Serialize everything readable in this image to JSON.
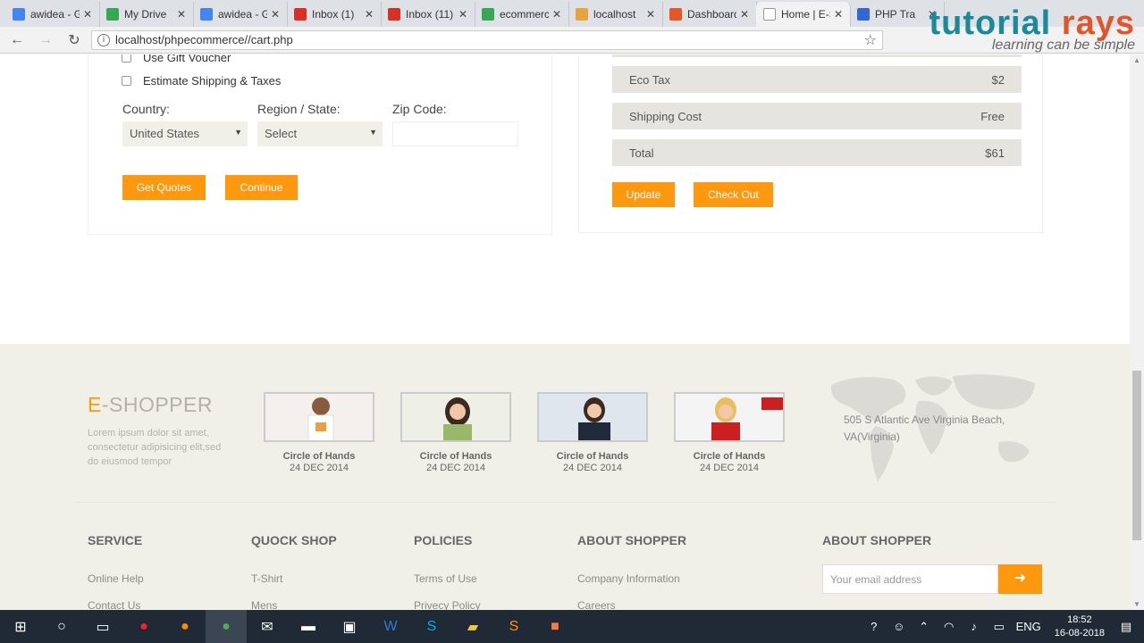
{
  "browser": {
    "tabs": [
      {
        "label": "awidea - Go",
        "color": "#4285f4"
      },
      {
        "label": "My Drive",
        "color": "#34a853"
      },
      {
        "label": "awidea - Go",
        "color": "#4285f4"
      },
      {
        "label": "Inbox (1)",
        "color": "#d93025"
      },
      {
        "label": "Inbox (11)",
        "color": "#d93025"
      },
      {
        "label": "ecommerce",
        "color": "#34a853"
      },
      {
        "label": "localhost",
        "color": "#e8a33d"
      },
      {
        "label": "Dashboard",
        "color": "#e65722"
      },
      {
        "label": "Home | E-Shopper",
        "color": "#999999"
      },
      {
        "label": "PHP Tra",
        "color": "#3367d6"
      }
    ],
    "url": "localhost/phpecommerce//cart.php"
  },
  "logo": {
    "brand_a": "tutorial ",
    "brand_b": "rays",
    "tagline": "learning can be simple"
  },
  "cart": {
    "gift_voucher_label": "Use Gift Voucher",
    "estimate_label": "Estimate Shipping & Taxes",
    "country_label": "Country:",
    "country_value": "United States",
    "region_label": "Region / State:",
    "region_value": "Select",
    "zip_label": "Zip Code:",
    "get_quotes": "Get Quotes",
    "continue": "Continue",
    "summary": [
      {
        "label": "Eco Tax",
        "value": "$2"
      },
      {
        "label": "Shipping Cost",
        "value": "Free"
      },
      {
        "label": "Total",
        "value": "$61"
      }
    ],
    "update": "Update",
    "checkout": "Check Out"
  },
  "footer": {
    "brand_e": "E",
    "brand_rest": "-SHOPPER",
    "blurb": "Lorem ipsum dolor sit amet, consectetur adipisicing elit,sed do eiusmod tempor",
    "videos": [
      {
        "caption": "Circle of Hands",
        "date": "24 DEC 2014"
      },
      {
        "caption": "Circle of Hands",
        "date": "24 DEC 2014"
      },
      {
        "caption": "Circle of Hands",
        "date": "24 DEC 2014"
      },
      {
        "caption": "Circle of Hands",
        "date": "24 DEC 2014"
      }
    ],
    "address": "505 S Atlantic Ave Virginia Beach, VA(Virginia)",
    "columns": [
      {
        "title": "SERVICE",
        "links": [
          "Online Help",
          "Contact Us"
        ]
      },
      {
        "title": "QUOCK SHOP",
        "links": [
          "T-Shirt",
          "Mens"
        ]
      },
      {
        "title": "POLICIES",
        "links": [
          "Terms of Use",
          "Privecy Policy"
        ]
      },
      {
        "title": "ABOUT SHOPPER",
        "links": [
          "Company Information",
          "Careers"
        ]
      }
    ],
    "subscribe_title": "ABOUT SHOPPER",
    "email_placeholder": "Your email address"
  },
  "taskbar": {
    "lang": "ENG",
    "time": "18:52",
    "date": "16-08-2018"
  }
}
